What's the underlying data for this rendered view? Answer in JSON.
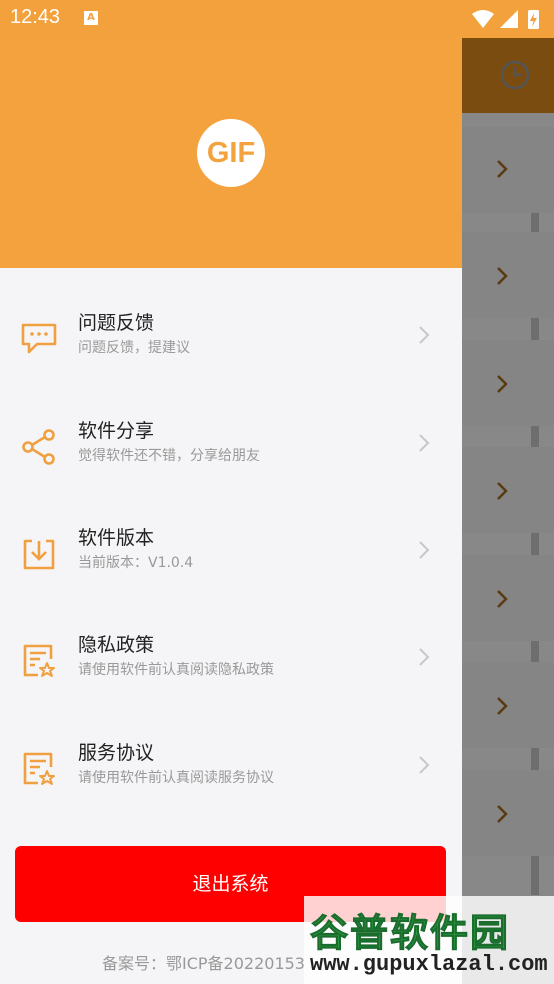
{
  "status_bar": {
    "time": "12:43",
    "notification_icon": "A"
  },
  "drawer": {
    "logo_text": "GIF",
    "menu": [
      {
        "title": "问题反馈",
        "subtitle": "问题反馈，提建议",
        "icon": "feedback-icon"
      },
      {
        "title": "软件分享",
        "subtitle": "觉得软件还不错，分享给朋友",
        "icon": "share-icon"
      },
      {
        "title": "软件版本",
        "subtitle": "当前版本：V1.0.4",
        "icon": "version-icon"
      },
      {
        "title": "隐私政策",
        "subtitle": "请使用软件前认真阅读隐私政策",
        "icon": "privacy-policy-icon"
      },
      {
        "title": "服务协议",
        "subtitle": "请使用软件前认真阅读服务协议",
        "icon": "service-agreement-icon"
      }
    ],
    "logout_label": "退出系统",
    "icp_text": "备案号：鄂ICP备20220153"
  },
  "watermark": {
    "title": "谷普软件园",
    "url": "www.gupuxlazal.com"
  },
  "colors": {
    "accent": "#f4a23e",
    "logout": "#ff0000",
    "drawer_bg": "#f5f5f7"
  }
}
